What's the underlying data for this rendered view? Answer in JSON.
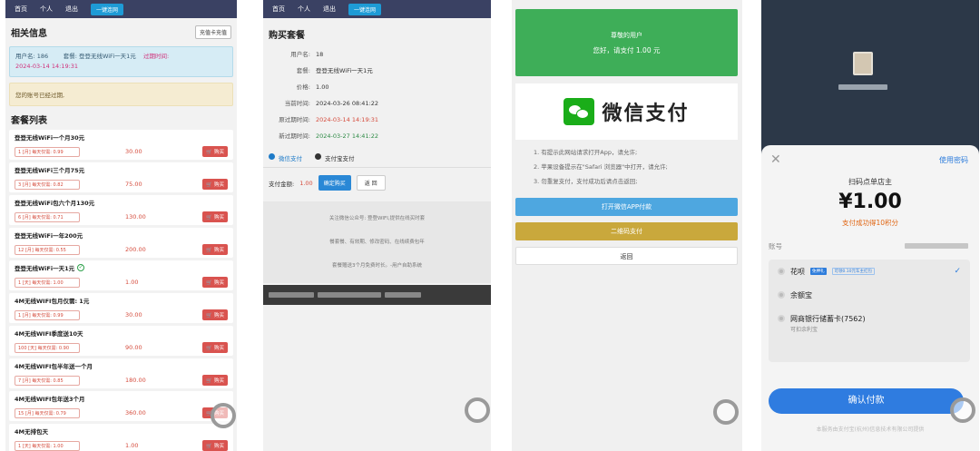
{
  "nav": {
    "items": [
      "首页",
      "个人",
      "退出"
    ],
    "tag": "一键连网"
  },
  "panel1": {
    "title": "相关信息",
    "recharge_btn": "充值卡充值",
    "info_user": "用户名: 186",
    "info_plan": "套餐: 登登无线WiFi一天1元",
    "info_expire_label": "过期时间:",
    "info_expire_value": "2024-03-14 14:19:31",
    "warn": "您的账号已经过期,",
    "list_title": "套餐列表",
    "plans": [
      {
        "name": "登登无线WiFi一个月30元",
        "tag": "1 [月]  每天仅需: 0.99",
        "price": "30.00",
        "buy": "购买"
      },
      {
        "name": "登登无线WiFi三个月75元",
        "tag": "3 [月]  每天仅需: 0.82",
        "price": "75.00",
        "buy": "购买"
      },
      {
        "name": "登登无线WiFi包六个月130元",
        "tag": "6 [月]  每天仅需: 0.71",
        "price": "130.00",
        "buy": "购买"
      },
      {
        "name": "登登无线WiFi一年200元",
        "tag": "12 [月]  每天仅需: 0.55",
        "price": "200.00",
        "buy": "购买"
      },
      {
        "name": "登登无线WiFi一天1元",
        "tag": "1 [天]  每天仅需: 1.00",
        "price": "1.00",
        "buy": "购买"
      },
      {
        "name": "4M无线WIFI包月仅需: 1元",
        "tag": "1 [月]  每天仅需: 0.99",
        "price": "30.00",
        "buy": "购买"
      },
      {
        "name": "4M无线WIFI季度送10天",
        "tag": "100 [天]  每天仅需: 0.90",
        "price": "90.00",
        "buy": "购买"
      },
      {
        "name": "4M无线WIFI包半年送一个月",
        "tag": "7 [月]  每天仅需: 0.85",
        "price": "180.00",
        "buy": "购买"
      },
      {
        "name": "4M无线WIFI包年送3个月",
        "tag": "15 [月]  每天仅需: 0.79",
        "price": "360.00",
        "buy": "购买"
      },
      {
        "name": "4M无排包天",
        "tag": "1 [天]  每天仅需: 1.00",
        "price": "1.00",
        "buy": "购买"
      }
    ]
  },
  "panel2": {
    "title": "购买套餐",
    "fields": [
      {
        "k": "用户名:",
        "v": "18",
        "style": ""
      },
      {
        "k": "套餐:",
        "v": "登登无线WiFi一天1元",
        "style": ""
      },
      {
        "k": "价格:",
        "v": "1.00",
        "style": ""
      },
      {
        "k": "当前时间:",
        "v": "2024-03-26 08:41:22",
        "style": ""
      },
      {
        "k": "原过期时间:",
        "v": "2024-03-14 14:19:31",
        "style": "red"
      },
      {
        "k": "新过期时间:",
        "v": "2024-03-27 14:41:22",
        "style": "green"
      }
    ],
    "tab_wechat": "微信支付",
    "tab_alipay": "支付宝支付",
    "amount_label": "支付金额:",
    "amount_value": "1.00",
    "confirm_btn": "确定购买",
    "back_btn": "返 回",
    "notice1": "关注微信公众号: 登登WIFI,提供在线买时套",
    "notice2": "餐套餐、有效期、修改密码、在线续费包年",
    "notice3": "套餐赠送3个月免费时长。-用户自助系统"
  },
  "panel3": {
    "greet": "尊敬的用户",
    "pay_text": "您好，请支付 1.00 元",
    "brand": "微信支付",
    "steps": [
      "1. 有提示此网站请求打开App，请允许;",
      "2. 苹果设备提示在\"Safari 浏览器\"中打开，请允许;",
      "3. 勿重复支付，支付成功后请点击返回;"
    ],
    "btn_open": "打开微信APP付款",
    "btn_qr": "二维码支付",
    "btn_back": "返回"
  },
  "panel4": {
    "use_pwd": "使用密码",
    "merchant": "扫码点单店主",
    "amount": "¥1.00",
    "points": "支付成功得10积分",
    "account_label": "账号",
    "methods": [
      {
        "name": "花呗",
        "badge": "免押礼",
        "note": "可领0.10元车主红包",
        "checked": true
      },
      {
        "name": "余额宝"
      },
      {
        "name": "网商银行储蓄卡(7562)",
        "sub": "可扣余利宝"
      }
    ],
    "confirm": "确认付款",
    "footer": "本服务由支付宝(杭州)信息技术有限公司提供"
  },
  "colors": {
    "nav": "#3a4163",
    "wechat_green": "#3eae58",
    "alipay_blue": "#2f7ce0",
    "buy_red": "#d9534f"
  }
}
